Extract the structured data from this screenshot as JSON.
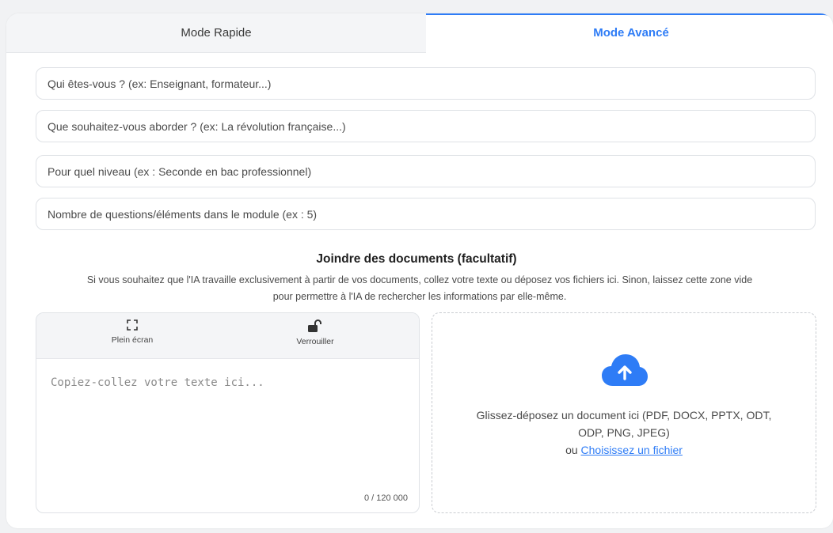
{
  "tabs": {
    "quick": "Mode Rapide",
    "advanced": "Mode Avancé"
  },
  "fields": {
    "who": "Qui êtes-vous ? (ex: Enseignant, formateur...)",
    "topic": "Que souhaitez-vous aborder ? (ex: La révolution française...)",
    "level": "Pour quel niveau (ex : Seconde en bac professionnel)",
    "count": "Nombre de questions/éléments dans le module (ex : 5)"
  },
  "docs": {
    "title": "Joindre des documents (facultatif)",
    "description_line1": "Si vous souhaitez que l'IA travaille exclusivement à partir de vos documents, collez votre texte ou déposez vos fichiers ici. Sinon, laissez cette zone vide",
    "description_line2": "pour permettre à l'IA de rechercher les informations par elle-même."
  },
  "editor": {
    "fullscreen_label": "Plein écran",
    "lock_label": "Verrouiller",
    "placeholder": "Copiez-collez votre texte ici...",
    "counter": "0 / 120 000",
    "fullscreen_icon": "fullscreen-icon",
    "lock_icon": "unlock-icon"
  },
  "dropzone": {
    "icon": "cloud-upload-icon",
    "line1": "Glissez-déposez un document ici (PDF, DOCX, PPTX, ODT,",
    "line2": "ODP, PNG, JPEG)",
    "or": "ou ",
    "link": "Choisissez un fichier"
  },
  "colors": {
    "accent": "#2e7cf6",
    "tab_inactive_bg": "#f4f5f7",
    "border": "#dfe2e6"
  }
}
